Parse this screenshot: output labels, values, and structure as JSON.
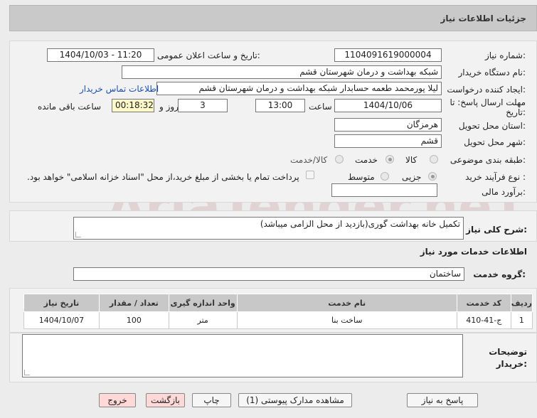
{
  "header": {
    "title": "جزئیات اطلاعات نیاز"
  },
  "form": {
    "need_number_label": "شماره نیاز:",
    "need_number": "1104091619000004",
    "announce_label": "تاریخ و ساعت اعلان عمومی:",
    "announce_value": "1404/10/03 - 11:20",
    "buyer_org_label": "نام دستگاه خریدار:",
    "buyer_org": "شبکه بهداشت و درمان شهرستان قشم",
    "creator_label": "ایجاد کننده درخواست:",
    "creator": "لیلا پورمحمد طعمه حسابدار شبکه بهداشت و درمان شهرستان قشم",
    "contact_link": "اطلاعات تماس خریدار",
    "deadline_label": "مهلت ارسال پاسخ: تا تاریخ:",
    "deadline_date": "1404/10/06",
    "time_label": "ساعت",
    "deadline_time": "13:00",
    "days": "3",
    "days_label": "روز و",
    "remaining": "00:18:32",
    "remaining_label": "ساعت باقی مانده",
    "province_label": "استان محل تحویل:",
    "province": "هرمزگان",
    "city_label": "شهر محل تحویل:",
    "city": "قشم",
    "category_label": "طبقه بندی موضوعی:",
    "category_options": [
      "کالا",
      "خدمت",
      "کالا/خدمت"
    ],
    "category_selected": "خدمت",
    "process_label": "نوع فرآیند خرید :",
    "process_options": [
      "جزیی",
      "متوسط"
    ],
    "process_selected": "جزیی",
    "payment_note": "پرداخت تمام یا بخشی از مبلغ خرید،از محل \"اسناد خزانه اسلامی\" خواهد بود.",
    "budget_label": "برآورد مالی:",
    "budget_value": ""
  },
  "description": {
    "label": "شرح کلی نیاز:",
    "text": "تکمیل خانه بهداشت گوری(بازدید از محل الزامی میباشد)"
  },
  "services": {
    "section_title": "اطلاعات خدمات مورد نیاز",
    "group_label": "گروه خدمت:",
    "group_value": "ساختمان",
    "columns": [
      "ردیف",
      "کد خدمت",
      "نام خدمت",
      "واحد اندازه گیری",
      "تعداد / مقدار",
      "تاریخ نیاز"
    ],
    "rows": [
      [
        "1",
        "ج-41-410",
        "ساخت بنا",
        "متر",
        "100",
        "1404/10/07"
      ]
    ]
  },
  "buyer_notes": {
    "label_line1": "توضیحات",
    "label_line2": "خریدار:",
    "text": ""
  },
  "buttons": {
    "reply": "پاسخ به نیاز",
    "attachments": "مشاهده مدارک پیوستی (1)",
    "print": "چاپ",
    "back": "بازگشت",
    "exit": "خروج"
  },
  "watermark": "AriaTender.neT",
  "colors": {
    "header_bg": "#c9c9c9",
    "link": "#1a4fb3",
    "yellow_field": "#fff8c8",
    "pink_button": "#ffd8d8"
  }
}
